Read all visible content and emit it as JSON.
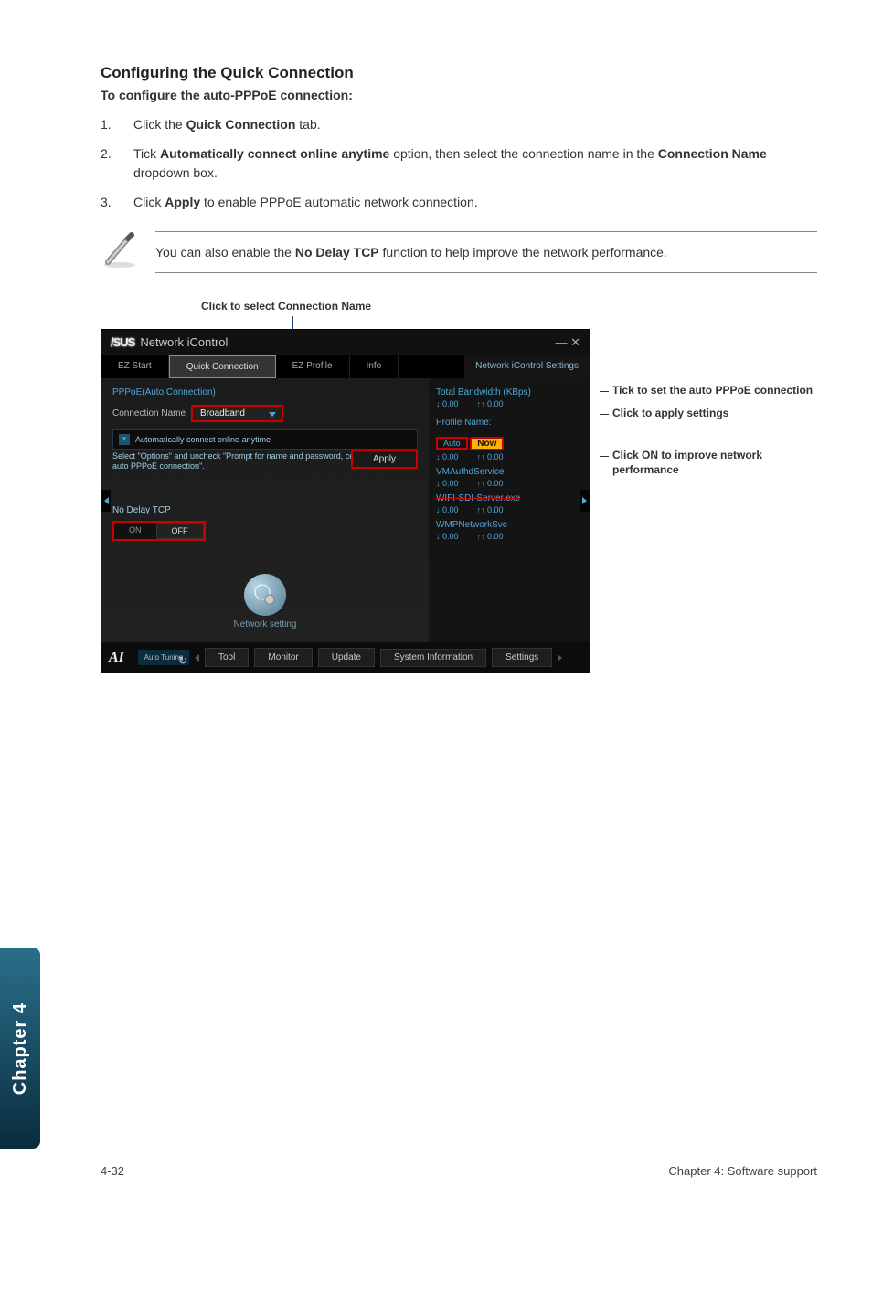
{
  "section": {
    "title": "Configuring the Quick Connection",
    "subhead": "To configure the auto-PPPoE connection:"
  },
  "steps": [
    {
      "num": "1.",
      "text_before": "Click the ",
      "bold": "Quick Connection",
      "text_after": " tab."
    },
    {
      "num": "2.",
      "text_before": "Tick ",
      "bold": "Automatically connect online anytime",
      "text_mid": " option, then select the connection name in the ",
      "bold2": "Connection Name",
      "text_after": " dropdown box."
    },
    {
      "num": "3.",
      "text_before": "Click ",
      "bold": "Apply",
      "text_after": " to enable PPPoE automatic network connection."
    }
  ],
  "note": {
    "text_before": "You can also enable the ",
    "bold": "No Delay TCP",
    "text_after": " function to help improve the network performance."
  },
  "caption": "Click to select Connection Name",
  "app": {
    "brand": "/SUS",
    "title": "Network iControl",
    "window_controls": "—   ✕",
    "tabs": {
      "ez_start": "EZ Start",
      "quick_connection": "Quick Connection",
      "ez_profile": "EZ Profile",
      "info": "Info"
    },
    "right_tab": "Network iControl Settings",
    "left": {
      "pppoe_label": "PPPoE(Auto Connection)",
      "conn_label": "Connection Name",
      "conn_value": "Broadband",
      "auto_check": "Automatically connect online anytime",
      "hint": "Select \"Options\" and uncheck \"Prompt for name and password, certificate, etc. for auto PPPoE connection\".",
      "apply": "Apply",
      "no_delay": "No Delay TCP",
      "on": "ON",
      "off": "OFF",
      "netset": "Network  setting"
    },
    "right": {
      "bw_label": "Total Bandwidth (KBps)",
      "down": "↓ 0.00",
      "up": "↑↑ 0.00",
      "profile_label": "Profile Name:",
      "profile_val": "Auto",
      "now": "Now",
      "svc1": "VMAuthdService",
      "svc1_d": "↓ 0.00",
      "svc1_u": "↑↑ 0.00",
      "svc2": "WIFI-SDI-Server.exe",
      "svc2_d": "↓ 0.00",
      "svc2_u": "↑↑ 0.00",
      "svc3": "WMPNetworkSvc",
      "svc3_d": "↓ 0.00",
      "svc3_u": "↑↑ 0.00"
    },
    "bottom": {
      "auto_tuning": "Auto Tuning",
      "tool": "Tool",
      "monitor": "Monitor",
      "update": "Update",
      "sysinfo": "System Information",
      "settings": "Settings"
    }
  },
  "callouts": {
    "c1": "Tick to set the auto PPPoE connection",
    "c2": "Click to apply settings",
    "c3": "Click ON to improve network performance"
  },
  "side_tab": "Chapter 4",
  "footer": {
    "left": "4-32",
    "right": "Chapter 4: Software support"
  }
}
